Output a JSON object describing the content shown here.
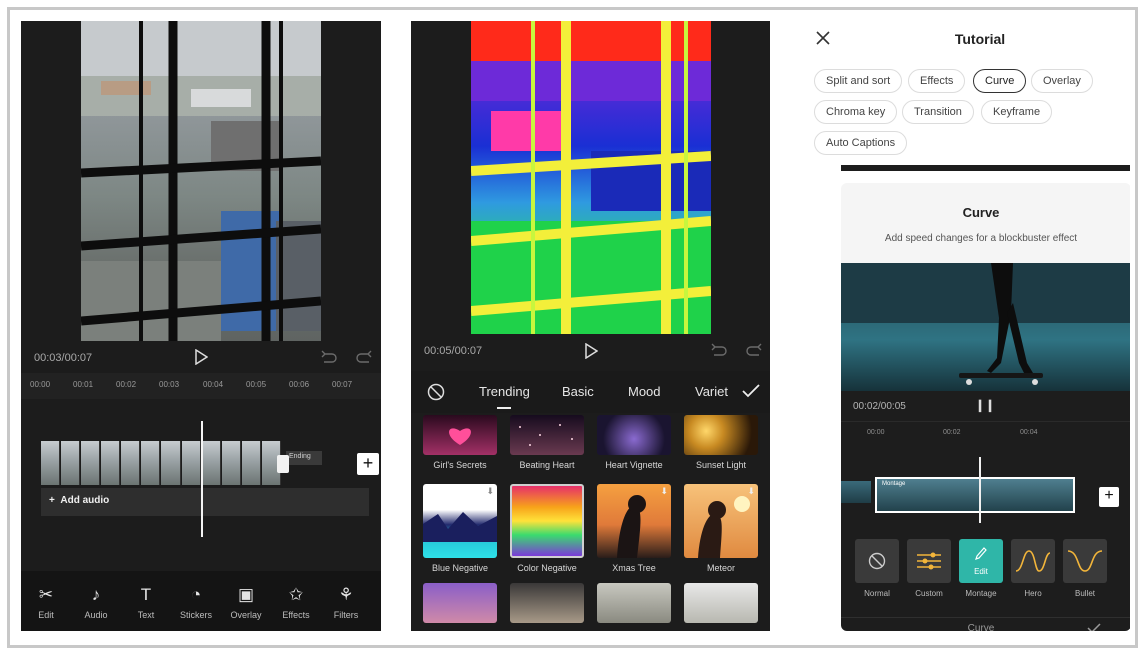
{
  "panel1": {
    "time": "00:03/00:07",
    "ruler": [
      "00:00",
      "00:01",
      "00:02",
      "00:03",
      "00:04",
      "00:05",
      "00:06",
      "00:07"
    ],
    "ending_label": "Ending",
    "add_audio_label": "Add audio",
    "toolbar": [
      {
        "label": "Edit",
        "icon": "scissors-icon",
        "glyph": "✂"
      },
      {
        "label": "Audio",
        "icon": "music-note-icon",
        "glyph": "♪"
      },
      {
        "label": "Text",
        "icon": "text-icon",
        "glyph": "T"
      },
      {
        "label": "Stickers",
        "icon": "sticker-icon",
        "glyph": "◔"
      },
      {
        "label": "Overlay",
        "icon": "overlay-icon",
        "glyph": "▣"
      },
      {
        "label": "Effects",
        "icon": "effects-star-icon",
        "glyph": "✩"
      },
      {
        "label": "Filters",
        "icon": "filters-icon",
        "glyph": "⚘"
      }
    ]
  },
  "panel2": {
    "time": "00:05/00:07",
    "tabs": [
      "Trending",
      "Basic",
      "Mood",
      "Variet"
    ],
    "active_tab": "Trending",
    "effects": [
      {
        "label": "Girl's Secrets",
        "colors": [
          "#2a0a1e",
          "#a33066"
        ]
      },
      {
        "label": "Beating Heart",
        "colors": [
          "#160b1e",
          "#6a3a50"
        ]
      },
      {
        "label": "Heart Vignette",
        "colors": [
          "#1a1430",
          "#4a3868"
        ]
      },
      {
        "label": "Sunset Light",
        "colors": [
          "#2a1808",
          "#c88a22"
        ]
      },
      {
        "label": "Blue Negative",
        "colors": [
          "#ffffff",
          "#26c7d9"
        ]
      },
      {
        "label": "Color Negative",
        "colors": [
          "#e6306a",
          "#7b3ad8"
        ]
      },
      {
        "label": "Xmas Tree",
        "colors": [
          "#f5a040",
          "#2a1d1a"
        ]
      },
      {
        "label": "Meteor",
        "colors": [
          "#f7c27a",
          "#e08a40"
        ]
      }
    ]
  },
  "panel3": {
    "title": "Tutorial",
    "chips": [
      "Split and sort",
      "Effects",
      "Curve",
      "Overlay",
      "Chroma key",
      "Transition",
      "Keyframe",
      "Auto Captions"
    ],
    "active_chip": "Curve",
    "card_title": "Curve",
    "card_subtitle": "Add speed changes for a blockbuster effect",
    "card_time": "00:02/00:05",
    "ruler": [
      "00:00",
      "00:02",
      "00:04"
    ],
    "clip_label": "Montage",
    "presets": [
      {
        "label": "Normal",
        "icon": "no-curve-icon"
      },
      {
        "label": "Custom",
        "icon": "sliders-icon"
      },
      {
        "label": "Montage",
        "icon": "edit-pencil-icon",
        "badge": "Edit"
      },
      {
        "label": "Hero",
        "icon": "curve-hero-icon"
      },
      {
        "label": "Bullet",
        "icon": "curve-bullet-icon"
      }
    ],
    "bottom_title": "Curve"
  }
}
